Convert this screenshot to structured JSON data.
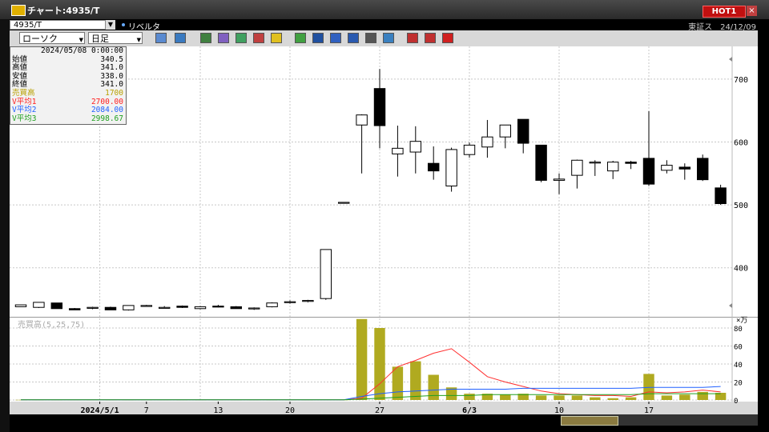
{
  "window": {
    "title": "チャート:4935/T",
    "hot_label": "HOT1",
    "close_label": "×"
  },
  "symbol_bar": {
    "code": "4935/T",
    "company": "リベルタ",
    "market_date": "東証ス　24/12/09"
  },
  "toolbar": {
    "chart_type": "ローソク",
    "period": "日足"
  },
  "info_panel": {
    "date": "2024/05/08 0:00:00",
    "rows": [
      {
        "k": "始値",
        "v": "340.5",
        "color": "#000000"
      },
      {
        "k": "高値",
        "v": "341.0",
        "color": "#000000"
      },
      {
        "k": "安値",
        "v": "338.0",
        "color": "#000000"
      },
      {
        "k": "終値",
        "v": "341.0",
        "color": "#000000"
      },
      {
        "k": "売買高",
        "v": "1700",
        "color": "#b8a000"
      },
      {
        "k": "V平均1",
        "v": "2700.00",
        "color": "#ff2020"
      },
      {
        "k": "V平均2",
        "v": "2084.00",
        "color": "#2060ff"
      },
      {
        "k": "V平均3",
        "v": "2998.67",
        "color": "#20a020"
      }
    ]
  },
  "chart_data": [
    {
      "type": "candlestick",
      "ylim": [
        322,
        752
      ],
      "ytick_labels": [
        "400",
        "500",
        "600",
        "700"
      ],
      "bar_width": 0.6,
      "candles": [
        {
          "o": 338,
          "h": 341,
          "l": 338,
          "c": 341
        },
        {
          "o": 337,
          "h": 345,
          "l": 336,
          "c": 345
        },
        {
          "o": 344,
          "h": 344,
          "l": 335,
          "c": 335
        },
        {
          "o": 335,
          "h": 336,
          "l": 333,
          "c": 333
        },
        {
          "o": 336,
          "h": 338,
          "l": 334,
          "c": 337
        },
        {
          "o": 337,
          "h": 338,
          "l": 333,
          "c": 333
        },
        {
          "o": 333,
          "h": 340,
          "l": 332,
          "c": 340
        },
        {
          "o": 339,
          "h": 341,
          "l": 338,
          "c": 340
        },
        {
          "o": 337,
          "h": 339,
          "l": 336,
          "c": 337
        },
        {
          "o": 339,
          "h": 340,
          "l": 336,
          "c": 337
        },
        {
          "o": 335,
          "h": 339,
          "l": 334,
          "c": 338
        },
        {
          "o": 339,
          "h": 341,
          "l": 337,
          "c": 338
        },
        {
          "o": 338,
          "h": 339,
          "l": 335,
          "c": 335
        },
        {
          "o": 335,
          "h": 337,
          "l": 333,
          "c": 336
        },
        {
          "o": 338,
          "h": 345,
          "l": 337,
          "c": 344
        },
        {
          "o": 345,
          "h": 348,
          "l": 343,
          "c": 346
        },
        {
          "o": 347,
          "h": 349,
          "l": 345,
          "c": 348
        },
        {
          "o": 351,
          "h": 429,
          "l": 349,
          "c": 429
        },
        {
          "o": 504,
          "h": 504,
          "l": 504,
          "c": 504
        },
        {
          "o": 627,
          "h": 644,
          "l": 550,
          "c": 643
        },
        {
          "o": 685,
          "h": 716,
          "l": 590,
          "c": 626
        },
        {
          "o": 581,
          "h": 626,
          "l": 545,
          "c": 590
        },
        {
          "o": 584,
          "h": 625,
          "l": 550,
          "c": 601
        },
        {
          "o": 566,
          "h": 593,
          "l": 540,
          "c": 554
        },
        {
          "o": 530,
          "h": 591,
          "l": 521,
          "c": 588
        },
        {
          "o": 580,
          "h": 599,
          "l": 575,
          "c": 595
        },
        {
          "o": 592,
          "h": 635,
          "l": 575,
          "c": 608
        },
        {
          "o": 608,
          "h": 625,
          "l": 590,
          "c": 627
        },
        {
          "o": 636,
          "h": 636,
          "l": 582,
          "c": 598
        },
        {
          "o": 595,
          "h": 595,
          "l": 536,
          "c": 539
        },
        {
          "o": 539,
          "h": 550,
          "l": 517,
          "c": 541
        },
        {
          "o": 547,
          "h": 572,
          "l": 526,
          "c": 571
        },
        {
          "o": 568,
          "h": 571,
          "l": 546,
          "c": 568
        },
        {
          "o": 554,
          "h": 570,
          "l": 541,
          "c": 568
        },
        {
          "o": 568,
          "h": 570,
          "l": 557,
          "c": 566
        },
        {
          "o": 574,
          "h": 649,
          "l": 530,
          "c": 533
        },
        {
          "o": 555,
          "h": 571,
          "l": 550,
          "c": 563
        },
        {
          "o": 560,
          "h": 566,
          "l": 540,
          "c": 557
        },
        {
          "o": 574,
          "h": 580,
          "l": 538,
          "c": 540
        },
        {
          "o": 527,
          "h": 532,
          "l": 500,
          "c": 502
        }
      ]
    },
    {
      "type": "bar",
      "title": "売買高(5,25,75)",
      "unit_label": "×万",
      "ylim": [
        0,
        88
      ],
      "ytick_labels": [
        "0",
        "20",
        "40",
        "60",
        "80"
      ],
      "values": [
        0.2,
        0.2,
        0.2,
        0.2,
        0.2,
        0.2,
        0.2,
        0.2,
        0.2,
        0.2,
        0.2,
        0.2,
        0.2,
        0.2,
        0.2,
        0.2,
        0.2,
        0.4,
        0.3,
        90,
        80,
        37,
        43,
        28,
        14,
        7,
        7,
        6,
        7,
        5,
        5,
        5,
        3,
        2,
        3,
        29,
        5,
        6,
        9,
        8
      ],
      "series": [
        {
          "name": "5",
          "color": "#ff3030",
          "values": [
            0.2,
            0.2,
            0.2,
            0.2,
            0.2,
            0.2,
            0.2,
            0.2,
            0.2,
            0.2,
            0.2,
            0.2,
            0.2,
            0.2,
            0.2,
            0.2,
            0.2,
            0.2,
            0.3,
            2,
            18,
            37,
            44,
            52,
            57,
            42,
            26,
            20,
            15,
            10,
            7,
            6,
            5,
            5,
            4,
            9,
            8,
            9,
            11,
            9
          ]
        },
        {
          "name": "25",
          "color": "#2060ff",
          "values": [
            0.2,
            0.2,
            0.2,
            0.2,
            0.2,
            0.2,
            0.2,
            0.2,
            0.2,
            0.2,
            0.2,
            0.2,
            0.2,
            0.2,
            0.2,
            0.2,
            0.2,
            0.2,
            0.3,
            4,
            7,
            9,
            10,
            11,
            12,
            12,
            12,
            12,
            13,
            13,
            13,
            13,
            13,
            13,
            13,
            14,
            14,
            14,
            14,
            15
          ]
        },
        {
          "name": "75",
          "color": "#20a020",
          "values": [
            0.2,
            0.2,
            0.2,
            0.2,
            0.2,
            0.2,
            0.2,
            0.2,
            0.2,
            0.2,
            0.2,
            0.2,
            0.2,
            0.2,
            0.2,
            0.2,
            0.2,
            0.2,
            0.3,
            1,
            2,
            3,
            4,
            5,
            5,
            5,
            6,
            6,
            6,
            6,
            6,
            6,
            6,
            6,
            6,
            7,
            7,
            7,
            7,
            7
          ]
        }
      ]
    },
    {
      "type": "axis",
      "x_ticks": [
        {
          "i": 4.4,
          "label": "2024/5/1",
          "bold": true
        },
        {
          "i": 7,
          "label": "7",
          "bold": false
        },
        {
          "i": 11,
          "label": "13",
          "bold": false
        },
        {
          "i": 15,
          "label": "20",
          "bold": false
        },
        {
          "i": 20,
          "label": "27",
          "bold": false
        },
        {
          "i": 25,
          "label": "6/3",
          "bold": true
        },
        {
          "i": 30,
          "label": "10",
          "bold": false
        },
        {
          "i": 35,
          "label": "17",
          "bold": false
        }
      ],
      "x_grid": [
        4.4,
        10,
        15,
        20,
        25,
        30,
        35
      ]
    }
  ]
}
